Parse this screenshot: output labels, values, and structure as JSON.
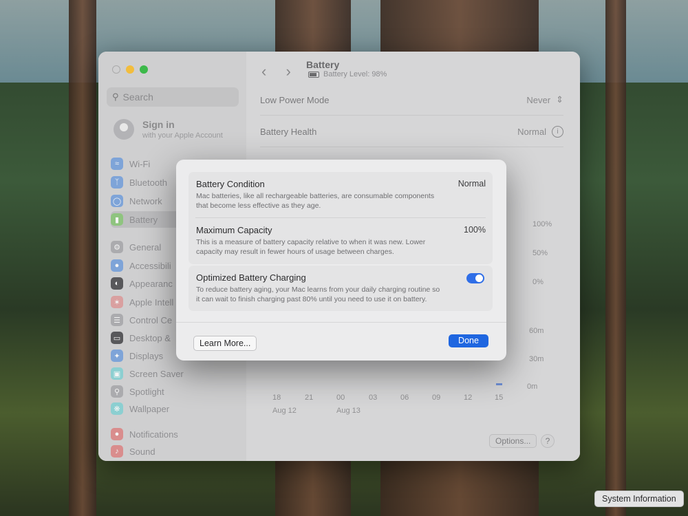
{
  "window": {
    "sidebar": {
      "search_placeholder": "Search",
      "account": {
        "title": "Sign in",
        "subtitle": "with your Apple Account"
      },
      "items": [
        {
          "label": "Wi-Fi",
          "icon": "wifi-icon",
          "color": "#5a8fd6"
        },
        {
          "label": "Bluetooth",
          "icon": "bluetooth-icon",
          "color": "#5a8fd6"
        },
        {
          "label": "Network",
          "icon": "globe-icon",
          "color": "#5a8fd6"
        },
        {
          "label": "Battery",
          "icon": "battery-icon",
          "color": "#6bbf59",
          "active": true
        },
        {
          "label": "General",
          "icon": "gear-icon",
          "color": "#9a9a9d"
        },
        {
          "label": "Accessibili",
          "icon": "accessibility-icon",
          "color": "#5a8fd6"
        },
        {
          "label": "Appearanc",
          "icon": "appearance-icon",
          "color": "#3a3a3c"
        },
        {
          "label": "Apple Intell",
          "icon": "apple-intelligence-icon",
          "color": "#d07a7a"
        },
        {
          "label": "Control Ce",
          "icon": "control-center-icon",
          "color": "#9a9a9d"
        },
        {
          "label": "Desktop &",
          "icon": "desktop-icon",
          "color": "#3a3a3c"
        },
        {
          "label": "Displays",
          "icon": "display-icon",
          "color": "#5a8fd6"
        },
        {
          "label": "Screen Saver",
          "icon": "screen-saver-icon",
          "color": "#6ac4c7"
        },
        {
          "label": "Spotlight",
          "icon": "spotlight-icon",
          "color": "#9a9a9d"
        },
        {
          "label": "Wallpaper",
          "icon": "wallpaper-icon",
          "color": "#6ac4c7"
        },
        {
          "label": "Notifications",
          "icon": "notifications-icon",
          "color": "#d06b6b"
        },
        {
          "label": "Sound",
          "icon": "sound-icon",
          "color": "#d06b6b"
        }
      ]
    },
    "header": {
      "title": "Battery",
      "subtitle": "Battery Level: 98%"
    },
    "rows": {
      "low_power": {
        "label": "Low Power Mode",
        "value": "Never"
      },
      "health": {
        "label": "Battery Health",
        "value": "Normal"
      }
    },
    "chart_axis": {
      "pct_ticks": [
        "100%",
        "50%",
        "0%"
      ],
      "time_ticks": [
        "60m",
        "30m",
        "0m"
      ],
      "x_ticks": [
        "18",
        "21",
        "00",
        "03",
        "06",
        "09",
        "12",
        "15"
      ],
      "dates": [
        "Aug 12",
        "Aug 13"
      ]
    },
    "footer": {
      "options": "Options...",
      "help": "?"
    }
  },
  "sheet": {
    "battery_condition": {
      "title": "Battery Condition",
      "value": "Normal",
      "description": "Mac batteries, like all rechargeable batteries, are consumable components that become less effective as they age."
    },
    "maximum_capacity": {
      "title": "Maximum Capacity",
      "value": "100%",
      "description": "This is a measure of battery capacity relative to when it was new. Lower capacity may result in fewer hours of usage between charges."
    },
    "optimized_charging": {
      "title": "Optimized Battery Charging",
      "enabled": true,
      "description": "To reduce battery aging, your Mac learns from your daily charging routine so it can wait to finish charging past 80% until you need to use it on battery."
    },
    "learn_more": "Learn More...",
    "done": "Done"
  },
  "system_information": "System Information"
}
